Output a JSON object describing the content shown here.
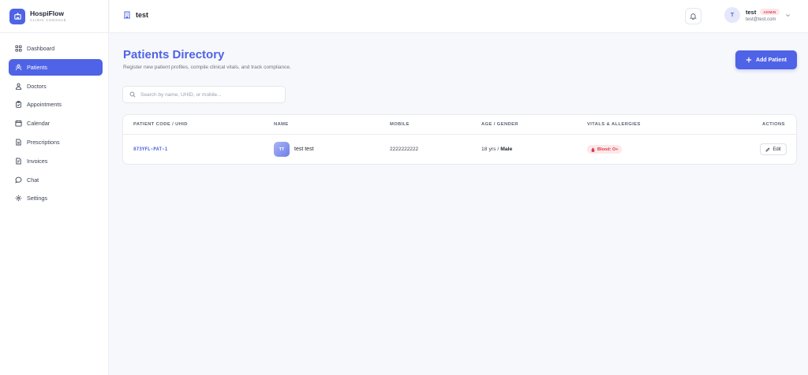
{
  "brand": {
    "name": "HospiFlow",
    "subtitle": "CLINIC CONSOLE"
  },
  "sidebar": {
    "items": [
      {
        "label": "Dashboard",
        "icon": "grid-icon",
        "active": false
      },
      {
        "label": "Patients",
        "icon": "patients-icon",
        "active": true
      },
      {
        "label": "Doctors",
        "icon": "doctor-icon",
        "active": false
      },
      {
        "label": "Appointments",
        "icon": "clipboard-icon",
        "active": false
      },
      {
        "label": "Calendar",
        "icon": "calendar-icon",
        "active": false
      },
      {
        "label": "Prescriptions",
        "icon": "document-icon",
        "active": false
      },
      {
        "label": "Invoices",
        "icon": "invoice-icon",
        "active": false
      },
      {
        "label": "Chat",
        "icon": "chat-icon",
        "active": false
      },
      {
        "label": "Settings",
        "icon": "gear-icon",
        "active": false
      }
    ]
  },
  "header": {
    "title": "test",
    "user": {
      "initial": "T",
      "name": "test",
      "role": "ADMIN",
      "email": "test@test.com"
    }
  },
  "main": {
    "title": "Patients Directory",
    "subtitle": "Register new patient profiles, compile clinical vitals, and track compliance.",
    "add_button": "Add Patient",
    "search": {
      "placeholder": "Search by name, UHID, or mobile...",
      "value": ""
    },
    "table": {
      "columns": [
        "PATIENT CODE / UHID",
        "NAME",
        "MOBILE",
        "AGE / GENDER",
        "VITALS & ALLERGIES",
        "ACTIONS"
      ],
      "rows": [
        {
          "code": "873YFL-PAT-1",
          "initials": "TT",
          "name": "test test",
          "mobile": "2222222222",
          "age": "18 yrs /",
          "gender": "Male",
          "blood": "Blood: O+",
          "action": "Edit"
        }
      ]
    }
  },
  "colors": {
    "accent": "#4f63e6",
    "danger": "#d93a4e",
    "background": "#f7f8fb"
  }
}
